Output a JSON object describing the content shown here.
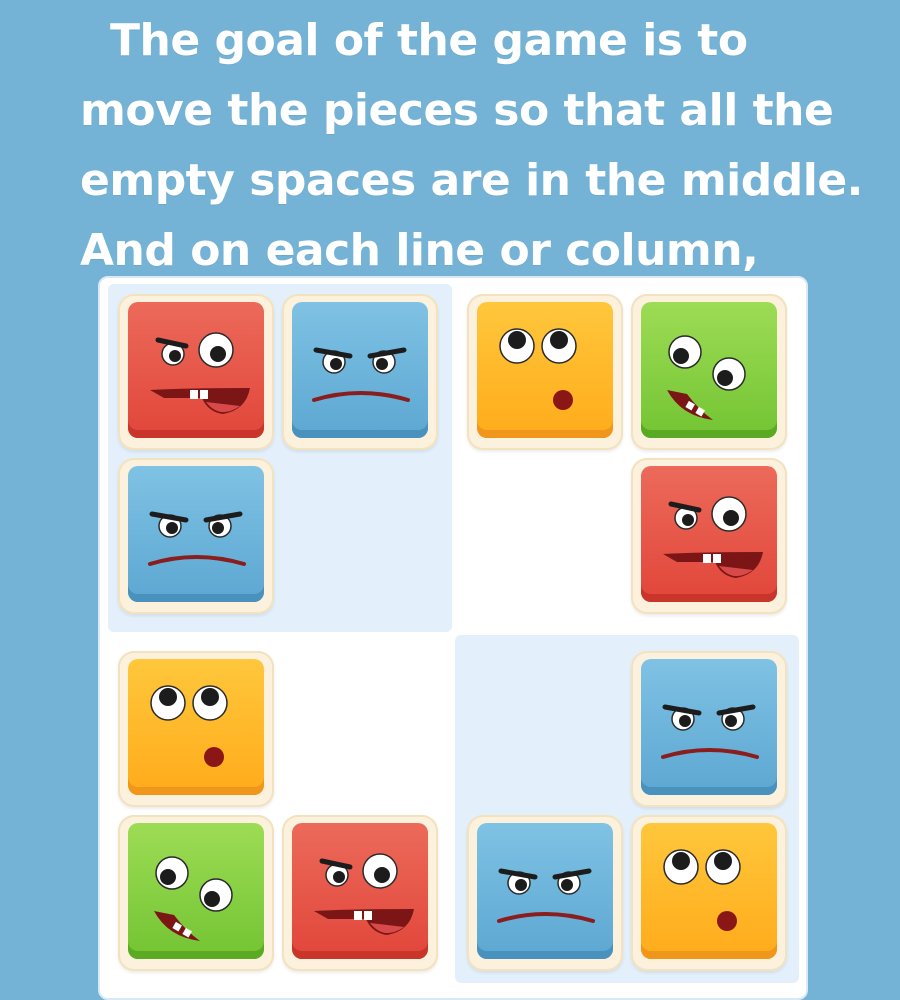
{
  "instructions": {
    "text": "The goal of the game is to move the pieces so that all the empty spaces are in the middle. And on each line or column,"
  },
  "board": {
    "quadrants": [
      {
        "name": "top-left",
        "shaded": true
      },
      {
        "name": "top-right",
        "shaded": false
      },
      {
        "name": "bottom-left",
        "shaded": false
      },
      {
        "name": "bottom-right",
        "shaded": true
      }
    ],
    "grid": [
      [
        "red-grin",
        "blue-frown",
        "yellow-surprised",
        "green-laugh"
      ],
      [
        "blue-frown",
        "empty",
        "empty",
        "red-grin"
      ],
      [
        "yellow-surprised",
        "empty",
        "empty",
        "blue-frown"
      ],
      [
        "green-laugh",
        "red-grin",
        "blue-frown",
        "yellow-surprised"
      ]
    ]
  },
  "colors": {
    "background": "#74b3d6",
    "red": "#e1463a",
    "blue": "#5ca7d2",
    "yellow": "#ffab1a",
    "green": "#73c433"
  }
}
